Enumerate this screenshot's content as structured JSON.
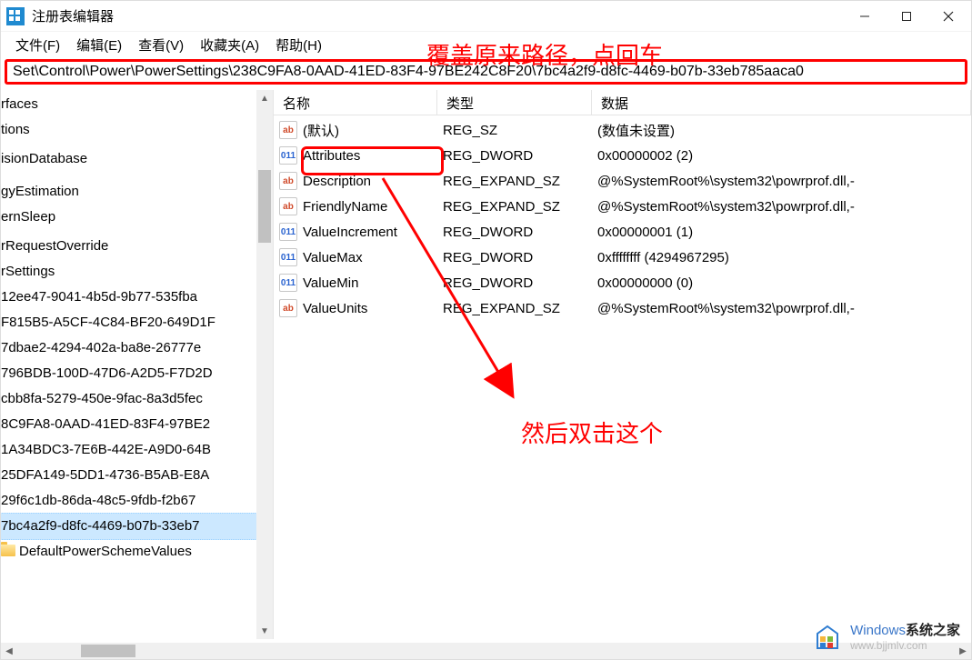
{
  "window": {
    "title": "注册表编辑器"
  },
  "menu": {
    "file": "文件(F)",
    "edit": "编辑(E)",
    "view": "查看(V)",
    "favorites": "收藏夹(A)",
    "help": "帮助(H)"
  },
  "addressbar": {
    "path": "Set\\Control\\Power\\PowerSettings\\238C9FA8-0AAD-41ED-83F4-97BE242C8F20\\7bc4a2f9-d8fc-4469-b07b-33eb785aaca0"
  },
  "annotations": {
    "top_text": "覆盖原来路径，点回车",
    "mid_text": "然后双击这个"
  },
  "tree": {
    "items": [
      "rfaces",
      "tions",
      "",
      "isionDatabase",
      "",
      "",
      "gyEstimation",
      "ernSleep",
      "",
      "rRequestOverride",
      "rSettings",
      "12ee47-9041-4b5d-9b77-535fba",
      "F815B5-A5CF-4C84-BF20-649D1F",
      "7dbae2-4294-402a-ba8e-26777e",
      "796BDB-100D-47D6-A2D5-F7D2D",
      "cbb8fa-5279-450e-9fac-8a3d5fec",
      "8C9FA8-0AAD-41ED-83F4-97BE2",
      "1A34BDC3-7E6B-442E-A9D0-64B",
      "25DFA149-5DD1-4736-B5AB-E8A",
      "29f6c1db-86da-48c5-9fdb-f2b67",
      "7bc4a2f9-d8fc-4469-b07b-33eb7",
      "DefaultPowerSchemeValues"
    ],
    "selected_index": 20
  },
  "list": {
    "headers": {
      "name": "名称",
      "type": "类型",
      "data": "数据"
    },
    "rows": [
      {
        "icon": "str",
        "name": "(默认)",
        "type": "REG_SZ",
        "data": "(数值未设置)"
      },
      {
        "icon": "bin",
        "name": "Attributes",
        "type": "REG_DWORD",
        "data": "0x00000002 (2)"
      },
      {
        "icon": "str",
        "name": "Description",
        "type": "REG_EXPAND_SZ",
        "data": "@%SystemRoot%\\system32\\powrprof.dll,-"
      },
      {
        "icon": "str",
        "name": "FriendlyName",
        "type": "REG_EXPAND_SZ",
        "data": "@%SystemRoot%\\system32\\powrprof.dll,-"
      },
      {
        "icon": "bin",
        "name": "ValueIncrement",
        "type": "REG_DWORD",
        "data": "0x00000001 (1)"
      },
      {
        "icon": "bin",
        "name": "ValueMax",
        "type": "REG_DWORD",
        "data": "0xffffffff (4294967295)"
      },
      {
        "icon": "bin",
        "name": "ValueMin",
        "type": "REG_DWORD",
        "data": "0x00000000 (0)"
      },
      {
        "icon": "str",
        "name": "ValueUnits",
        "type": "REG_EXPAND_SZ",
        "data": "@%SystemRoot%\\system32\\powrprof.dll,-"
      }
    ]
  },
  "watermark": {
    "line1_a": "Windows",
    "line1_b": "系统之家",
    "line2": "www.bjjmlv.com"
  }
}
